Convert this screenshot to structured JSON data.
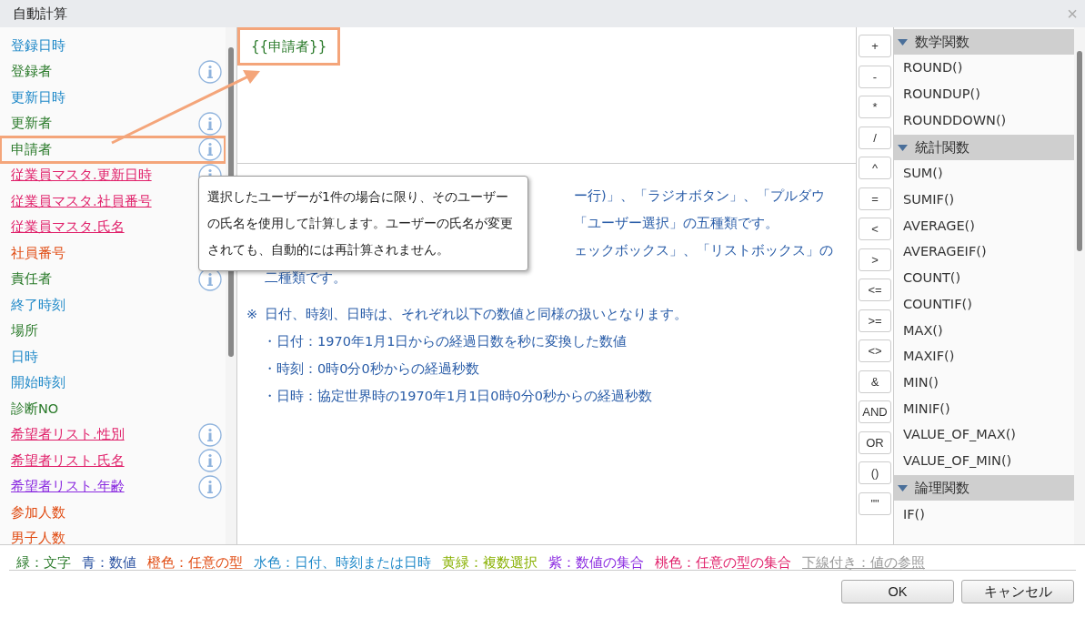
{
  "window": {
    "title": "自動計算",
    "close": "×"
  },
  "fields": [
    {
      "name": "登録日時",
      "color": "#1e88c8",
      "underlined": false,
      "info": false,
      "highlighted": false
    },
    {
      "name": "登録者",
      "color": "#2a7a2a",
      "underlined": false,
      "info": true,
      "highlighted": false
    },
    {
      "name": "更新日時",
      "color": "#1e88c8",
      "underlined": false,
      "info": false,
      "highlighted": false
    },
    {
      "name": "更新者",
      "color": "#2a7a2a",
      "underlined": false,
      "info": true,
      "highlighted": false
    },
    {
      "name": "申請者",
      "color": "#2a7a2a",
      "underlined": false,
      "info": true,
      "highlighted": true
    },
    {
      "name": "従業員マスタ.更新日時",
      "color": "#e0206a",
      "underlined": true,
      "info": true,
      "highlighted": false
    },
    {
      "name": "従業員マスタ.社員番号",
      "color": "#e0206a",
      "underlined": true,
      "highlighted": false
    },
    {
      "name": "従業員マスタ.氏名",
      "color": "#e0206a",
      "underlined": true,
      "highlighted": false
    },
    {
      "name": "社員番号",
      "color": "#e04a10",
      "underlined": false,
      "highlighted": false
    },
    {
      "name": "責任者",
      "color": "#2a7a2a",
      "underlined": false,
      "info": true,
      "highlighted": false
    },
    {
      "name": "終了時刻",
      "color": "#1e88c8",
      "underlined": false,
      "info": false,
      "highlighted": false
    },
    {
      "name": "場所",
      "color": "#2a7a2a",
      "underlined": false,
      "info": false,
      "highlighted": false
    },
    {
      "name": "日時",
      "color": "#1e88c8",
      "underlined": false,
      "info": false,
      "highlighted": false
    },
    {
      "name": "開始時刻",
      "color": "#1e88c8",
      "underlined": false,
      "info": false,
      "highlighted": false
    },
    {
      "name": "診断NO",
      "color": "#2a7a2a",
      "underlined": false,
      "info": false,
      "highlighted": false
    },
    {
      "name": "希望者リスト.性別",
      "color": "#e0206a",
      "underlined": true,
      "info": true,
      "highlighted": false
    },
    {
      "name": "希望者リスト.氏名",
      "color": "#e0206a",
      "underlined": true,
      "info": true,
      "highlighted": false
    },
    {
      "name": "希望者リスト.年齢",
      "color": "#8a2ae0",
      "underlined": true,
      "info": true,
      "highlighted": false
    },
    {
      "name": "参加人数",
      "color": "#e04a10",
      "underlined": false,
      "info": false,
      "highlighted": false
    },
    {
      "name": "男子人数",
      "color": "#e04a10",
      "underlined": false,
      "info": false,
      "highlighted": false
    }
  ],
  "editor": {
    "value": "{{申請者}}",
    "highlighted": true
  },
  "description": [
    {
      "kind": "fragment",
      "text": "ー行)」、「ラジオボタン」、「プルダウ"
    },
    {
      "kind": "fragment",
      "text": "「ユーザー選択」の五種類です。"
    },
    {
      "kind": "fragment",
      "text": "ェックボックス」、「リストボックス」の"
    },
    {
      "kind": "continuation",
      "text": "二種類です。"
    },
    {
      "kind": "note",
      "mark": "※",
      "text": "日付、時刻、日時は、それぞれ以下の数値と同様の扱いとなります。"
    },
    {
      "kind": "bullet",
      "text": "・日付：1970年1月1日からの経過日数を秒に変換した数値"
    },
    {
      "kind": "bullet",
      "text": "・時刻：0時0分0秒からの経過秒数"
    },
    {
      "kind": "bullet",
      "text": "・日時：協定世界時の1970年1月1日0時0分0秒からの経過秒数"
    }
  ],
  "tooltip": {
    "text": "選択したユーザーが1件の場合に限り、そのユーザーの氏名を使用して計算します。ユーザーの氏名が変更されても、自動的には再計算されません。"
  },
  "operators": [
    "+",
    "-",
    "*",
    "/",
    "^",
    "=",
    "<",
    ">",
    "<=",
    ">=",
    "<>",
    "&",
    "AND",
    "OR",
    "()",
    "\"\""
  ],
  "function_groups": [
    {
      "title": "数学関数",
      "expanded": true,
      "items": [
        "ROUND()",
        "ROUNDUP()",
        "ROUNDDOWN()"
      ]
    },
    {
      "title": "統計関数",
      "expanded": true,
      "items": [
        "SUM()",
        "SUMIF()",
        "AVERAGE()",
        "AVERAGEIF()",
        "COUNT()",
        "COUNTIF()",
        "MAX()",
        "MAXIF()",
        "MIN()",
        "MINIF()",
        "VALUE_OF_MAX()",
        "VALUE_OF_MIN()"
      ]
    },
    {
      "title": "論理関数",
      "expanded": true,
      "items": [
        "IF()"
      ]
    }
  ],
  "legend": [
    {
      "text": "緑：文字",
      "color": "#2a7a2a",
      "underlined": false
    },
    {
      "text": "青：数値",
      "color": "#2850a0",
      "underlined": false
    },
    {
      "text": "橙色：任意の型",
      "color": "#e04a10",
      "underlined": false
    },
    {
      "text": "水色：日付、時刻または日時",
      "color": "#1e88c8",
      "underlined": false
    },
    {
      "text": "黄緑：複数選択",
      "color": "#88b000",
      "underlined": false
    },
    {
      "text": "紫：数値の集合",
      "color": "#8a2ae0",
      "underlined": false
    },
    {
      "text": "桃色：任意の型の集合",
      "color": "#e0206a",
      "underlined": false
    },
    {
      "text": "下線付き：値の参照",
      "color": "#999999",
      "underlined": true
    }
  ],
  "buttons": [
    "OK",
    "キャンセル"
  ]
}
